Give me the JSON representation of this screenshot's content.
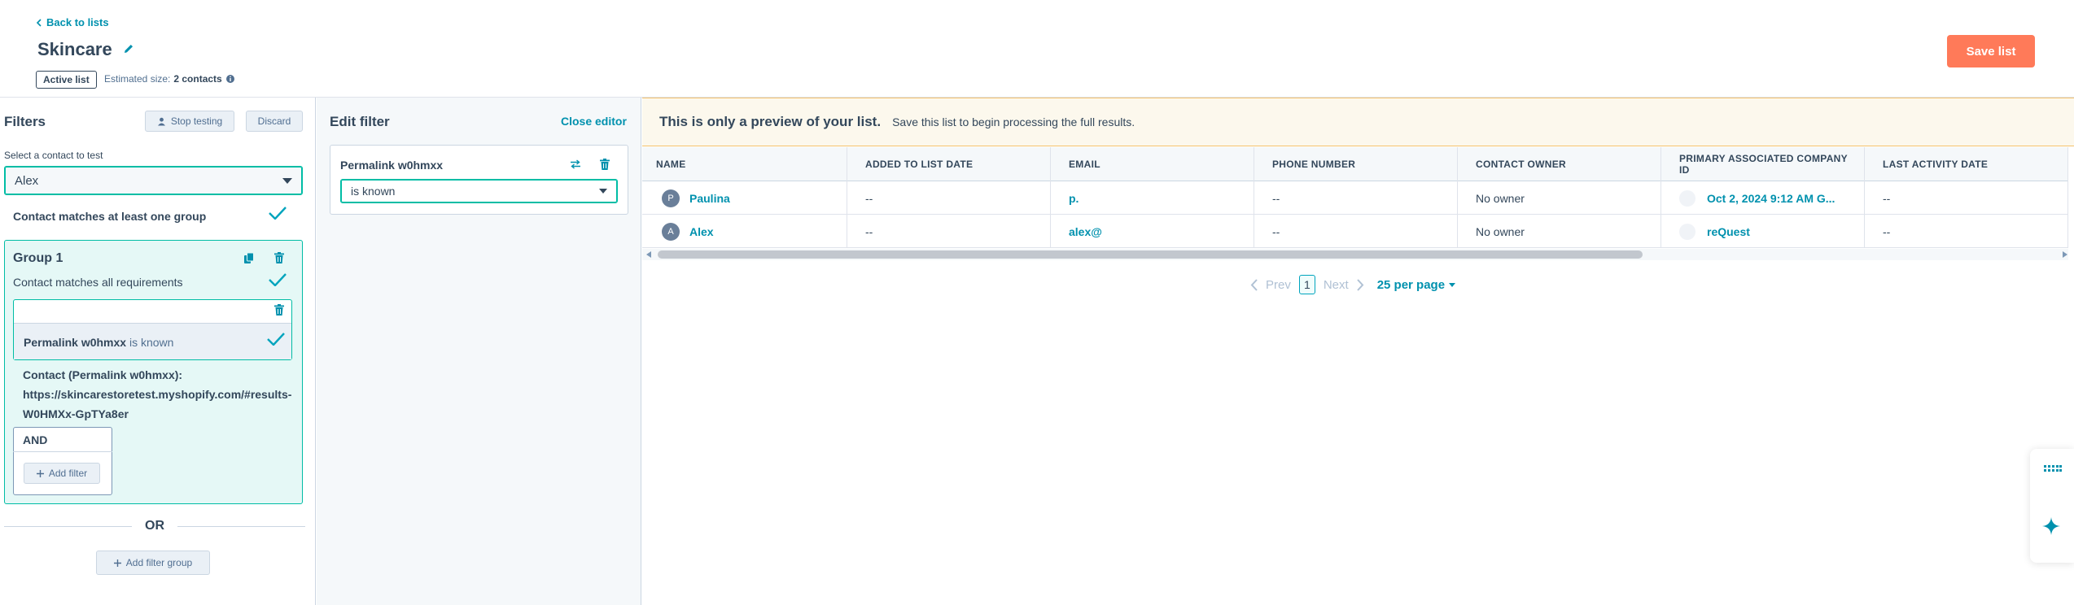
{
  "header": {
    "back_label": "Back to lists",
    "title": "Skincare",
    "status_badge": "Active list",
    "estimated_label": "Estimated size:",
    "estimated_value": "2 contacts",
    "save_label": "Save list"
  },
  "filters": {
    "title": "Filters",
    "stop_testing_label": "Stop testing",
    "discard_label": "Discard",
    "test_contact_label": "Select a contact to test",
    "test_contact_value": "Alex",
    "match_text": "Contact matches at least one group",
    "group": {
      "title": "Group 1",
      "requirement_text": "Contact matches all requirements",
      "rule_property": "Permalink w0hmxx",
      "rule_operator": "is known",
      "contact_value_label": "Contact (Permalink w0hmxx):",
      "contact_value_line1": "https://skincarestoretest.myshopify.com/#results-",
      "contact_value_line2": "W0HMXx-GpTYa8er",
      "and_label": "AND",
      "add_filter_label": "Add filter"
    },
    "or_label": "OR",
    "add_group_label": "Add filter group"
  },
  "edit_filter": {
    "title": "Edit filter",
    "close_label": "Close editor",
    "property": "Permalink w0hmxx",
    "operator": "is known"
  },
  "preview": {
    "banner_title": "This is only a preview of your list.",
    "banner_text": "Save this list to begin processing the full results.",
    "columns": [
      "NAME",
      "ADDED TO LIST DATE",
      "EMAIL",
      "PHONE NUMBER",
      "CONTACT OWNER",
      "PRIMARY ASSOCIATED COMPANY ID",
      "LAST ACTIVITY DATE"
    ],
    "rows": [
      {
        "initial": "P",
        "name": "Paulina",
        "added": "--",
        "email": "p.",
        "phone": "--",
        "owner": "No owner",
        "company": "Oct 2, 2024 9:12 AM G...",
        "activity": "--"
      },
      {
        "initial": "A",
        "name": "Alex",
        "added": "--",
        "email": "alex@",
        "phone": "--",
        "owner": "No owner",
        "company": "reQuest",
        "activity": "--"
      }
    ],
    "pager": {
      "prev": "Prev",
      "page": "1",
      "next": "Next",
      "per_page": "25 per page"
    }
  },
  "colors": {
    "accent": "#ff7a59",
    "teal": "#00bda5",
    "link": "#0091ae"
  }
}
